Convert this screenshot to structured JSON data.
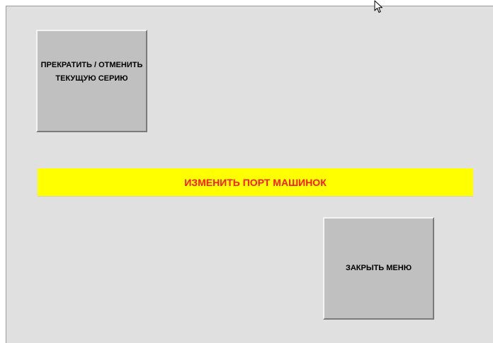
{
  "buttons": {
    "cancel_line1": "ПРЕКРАТИТЬ / ОТМЕНИТЬ",
    "cancel_line2": "ТЕКУЩУЮ СЕРИЮ",
    "change_port": "ИЗМЕНИТЬ ПОРТ МАШИНОК",
    "close_menu": "ЗАКРЫТЬ МЕНЮ"
  },
  "colors": {
    "window_bg": "#e0e0e0",
    "button_bg": "#c0c0c0",
    "banner_bg": "#ffff00",
    "banner_text": "#ff1a1a"
  },
  "icons": {
    "cursor": "mouse-pointer-icon"
  }
}
